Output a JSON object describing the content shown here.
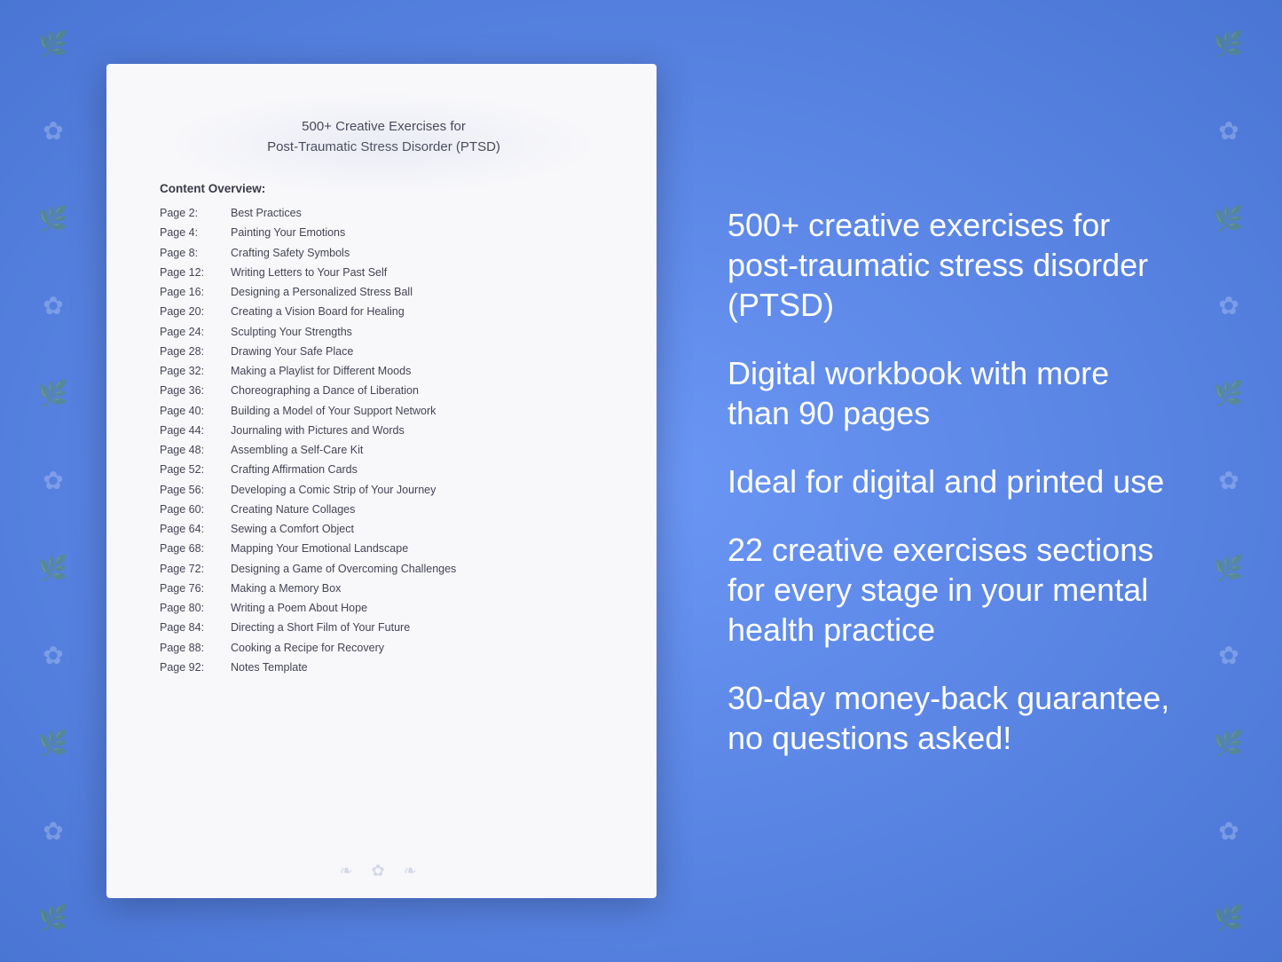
{
  "background": {
    "color": "#5b86e5"
  },
  "document": {
    "title_line1": "500+ Creative Exercises for",
    "title_line2": "Post-Traumatic Stress Disorder (PTSD)",
    "content_overview_label": "Content Overview:",
    "toc": [
      {
        "page": "Page  2:",
        "title": "Best Practices"
      },
      {
        "page": "Page  4:",
        "title": "Painting Your Emotions"
      },
      {
        "page": "Page  8:",
        "title": "Crafting Safety Symbols"
      },
      {
        "page": "Page 12:",
        "title": "Writing Letters to Your Past Self"
      },
      {
        "page": "Page 16:",
        "title": "Designing a Personalized Stress Ball"
      },
      {
        "page": "Page 20:",
        "title": "Creating a Vision Board for Healing"
      },
      {
        "page": "Page 24:",
        "title": "Sculpting Your Strengths"
      },
      {
        "page": "Page 28:",
        "title": "Drawing Your Safe Place"
      },
      {
        "page": "Page 32:",
        "title": "Making a Playlist for Different Moods"
      },
      {
        "page": "Page 36:",
        "title": "Choreographing a Dance of Liberation"
      },
      {
        "page": "Page 40:",
        "title": "Building a Model of Your Support Network"
      },
      {
        "page": "Page 44:",
        "title": "Journaling with Pictures and Words"
      },
      {
        "page": "Page 48:",
        "title": "Assembling a Self-Care Kit"
      },
      {
        "page": "Page 52:",
        "title": "Crafting Affirmation Cards"
      },
      {
        "page": "Page 56:",
        "title": "Developing a Comic Strip of Your Journey"
      },
      {
        "page": "Page 60:",
        "title": "Creating Nature Collages"
      },
      {
        "page": "Page 64:",
        "title": "Sewing a Comfort Object"
      },
      {
        "page": "Page 68:",
        "title": "Mapping Your Emotional Landscape"
      },
      {
        "page": "Page 72:",
        "title": "Designing a Game of Overcoming Challenges"
      },
      {
        "page": "Page 76:",
        "title": "Making a Memory Box"
      },
      {
        "page": "Page 80:",
        "title": "Writing a Poem About Hope"
      },
      {
        "page": "Page 84:",
        "title": "Directing a Short Film of Your Future"
      },
      {
        "page": "Page 88:",
        "title": "Cooking a Recipe for Recovery"
      },
      {
        "page": "Page 92:",
        "title": "Notes Template"
      }
    ]
  },
  "info_panel": {
    "block1": "500+ creative exercises for post-traumatic stress disorder (PTSD)",
    "block2": "Digital workbook with more than 90 pages",
    "block3": "Ideal for digital and printed use",
    "block4": "22 creative exercises sections for every stage in your mental health practice",
    "block5": "30-day money-back guarantee, no questions asked!"
  },
  "floral": {
    "sprigs": [
      "🌿",
      "✿",
      "🌿",
      "✿",
      "🌿",
      "✿",
      "🌿",
      "✿",
      "🌿",
      "✿",
      "🌿",
      "✿",
      "🌿"
    ]
  }
}
